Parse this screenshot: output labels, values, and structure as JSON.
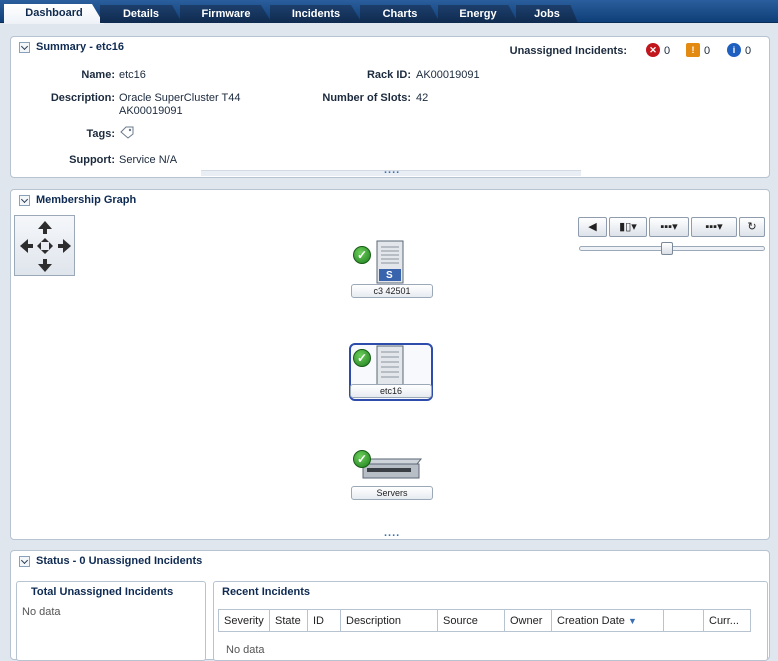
{
  "tabs": [
    {
      "label": "Dashboard",
      "active": true
    },
    {
      "label": "Details"
    },
    {
      "label": "Firmware"
    },
    {
      "label": "Incidents"
    },
    {
      "label": "Charts"
    },
    {
      "label": "Energy"
    },
    {
      "label": "Jobs"
    }
  ],
  "summary": {
    "title": "Summary - etc16",
    "unassigned_label": "Unassigned Incidents:",
    "counts": {
      "critical": "0",
      "warning": "0",
      "info": "0"
    },
    "name_label": "Name:",
    "name": "etc16",
    "description_label": "Description:",
    "description_line1": "Oracle SuperCluster T44",
    "description_line2": "AK00019091",
    "tags_label": "Tags:",
    "support_label": "Support:",
    "support": "Service N/A",
    "rack_label": "Rack ID:",
    "rack": "AK00019091",
    "slots_label": "Number of Slots:",
    "slots": "42",
    "more": "...."
  },
  "graph": {
    "title": "Membership Graph",
    "nodes": [
      {
        "label": "c3 42501",
        "badge": "S"
      },
      {
        "label": "etc16"
      },
      {
        "label": "Servers"
      }
    ],
    "more": "...."
  },
  "status": {
    "title": "Status - 0 Unassigned Incidents",
    "total_title": "Total Unassigned Incidents",
    "total_nodata": "No data",
    "recent_title": "Recent Incidents",
    "columns": [
      "Severity",
      "State",
      "ID",
      "Description",
      "Source",
      "Owner",
      "Creation Date",
      "",
      "Curr..."
    ],
    "recent_nodata": "No data"
  },
  "colors": {
    "critical": "#c0161c",
    "warning": "#e38a12",
    "info": "#1f5fbf",
    "accent": "#0e2a52"
  }
}
